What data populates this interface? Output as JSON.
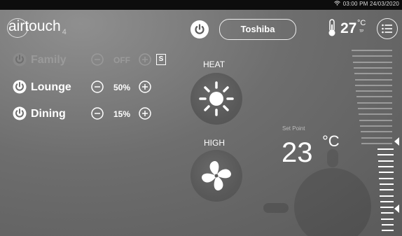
{
  "status_bar": {
    "time": "03:00 PM 24/03/2020"
  },
  "header": {
    "logo_text": "airtouch",
    "logo_suffix": "4",
    "brand": "Toshiba",
    "current_temp": "27",
    "temp_unit": "°C",
    "temp_sub": "TP"
  },
  "zones": [
    {
      "name": "Family",
      "value": "OFF",
      "badge": "S",
      "on": false
    },
    {
      "name": "Lounge",
      "value": "50%",
      "on": true
    },
    {
      "name": "Dining",
      "value": "15%",
      "on": true
    }
  ],
  "mode": {
    "label": "HEAT",
    "icon": "sun-icon"
  },
  "fan": {
    "label": "HIGH",
    "icon": "fan-icon"
  },
  "setpoint": {
    "label": "Set Point",
    "value": "23",
    "unit": "°C"
  },
  "colors": {
    "background": "#6e6e6e",
    "status_bar": "#0d0d0d",
    "foreground": "#ffffff",
    "dim": "#9a9a9a"
  }
}
